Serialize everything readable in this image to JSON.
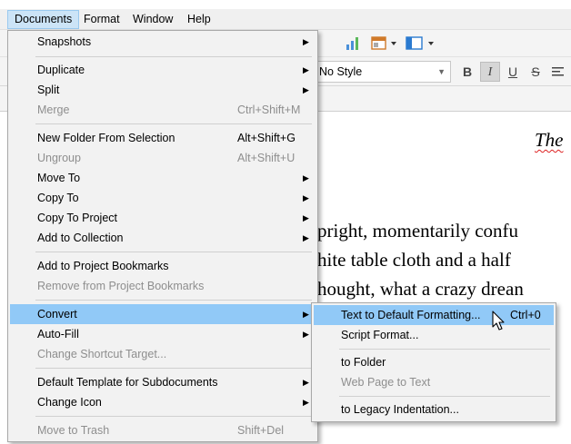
{
  "menubar": {
    "items": [
      "Documents",
      "Format",
      "Window",
      "Help"
    ]
  },
  "toolbar": {
    "style_value": "No Style",
    "bold": "B",
    "italic": "I",
    "underline": "U",
    "strike": "S"
  },
  "editor": {
    "line1": "The",
    "line2": "pright, momentarily confu",
    "line3": "hite table cloth and a half",
    "line4": "hought, what a crazy drean"
  },
  "documents_menu": {
    "snapshots": "Snapshots",
    "duplicate": "Duplicate",
    "split": "Split",
    "merge": "Merge",
    "merge_sc": "Ctrl+Shift+M",
    "new_folder": "New Folder From Selection",
    "new_folder_sc": "Alt+Shift+G",
    "ungroup": "Ungroup",
    "ungroup_sc": "Alt+Shift+U",
    "move_to": "Move To",
    "copy_to": "Copy To",
    "copy_to_project": "Copy To Project",
    "add_to_collection": "Add to Collection",
    "add_bookmarks": "Add to Project Bookmarks",
    "remove_bookmarks": "Remove from Project Bookmarks",
    "convert": "Convert",
    "auto_fill": "Auto-Fill",
    "change_shortcut": "Change Shortcut Target...",
    "default_template": "Default Template for Subdocuments",
    "change_icon": "Change Icon",
    "move_to_trash": "Move to Trash",
    "move_to_trash_sc": "Shift+Del"
  },
  "convert_menu": {
    "text_default": "Text to Default Formatting...",
    "text_default_sc": "Ctrl+0",
    "script_format": "Script Format...",
    "to_folder": "to Folder",
    "web_page": "Web Page to Text",
    "legacy": "to Legacy Indentation..."
  },
  "colors": {
    "highlight": "#91c9f7",
    "menubar_active": "#cce4f7",
    "disabled_text": "#8e8e8e"
  }
}
